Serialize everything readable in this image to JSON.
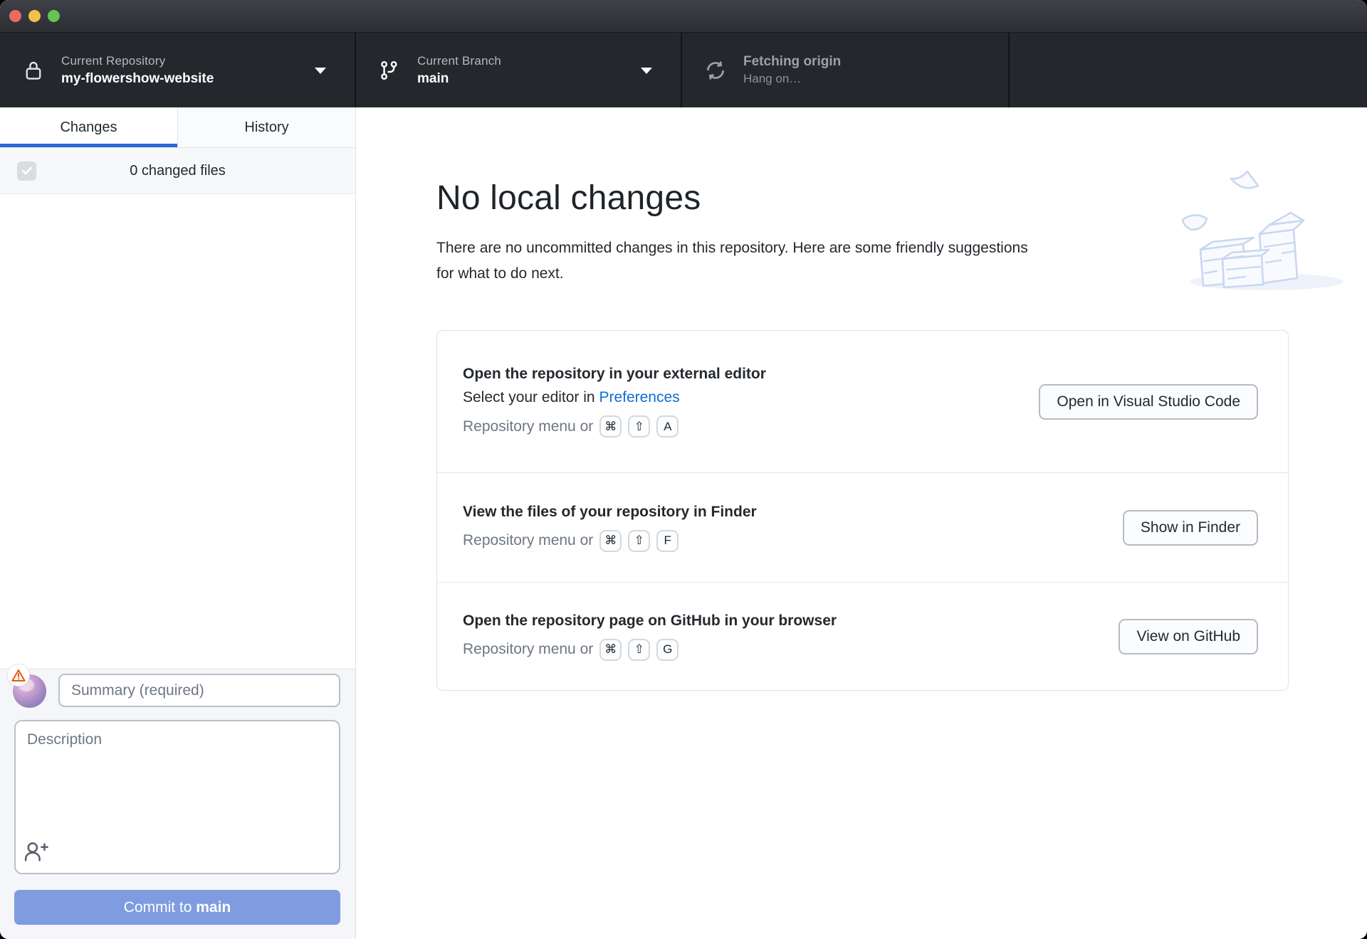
{
  "toolbar": {
    "repository": {
      "label": "Current Repository",
      "value": "my-flowershow-website"
    },
    "branch": {
      "label": "Current Branch",
      "value": "main"
    },
    "fetch": {
      "title": "Fetching origin",
      "subtitle": "Hang on…"
    }
  },
  "sidebar": {
    "tabs": [
      {
        "label": "Changes"
      },
      {
        "label": "History"
      }
    ],
    "changes_summary": "0 changed files",
    "commit": {
      "summary_placeholder": "Summary (required)",
      "description_placeholder": "Description",
      "button_prefix": "Commit to ",
      "button_branch": "main"
    }
  },
  "main": {
    "title": "No local changes",
    "subtitle_lines": [
      "There are no uncommitted changes in this repository. Here are some friendly suggestions",
      "for what to do next."
    ],
    "suggestions": [
      {
        "title": "Open the repository in your external editor",
        "subtitle_prefix": "Select your editor in ",
        "subtitle_link": "Preferences",
        "shortcut_prefix": "Repository menu or",
        "keys": [
          "⌘",
          "⇧",
          "A"
        ],
        "button": "Open in Visual Studio Code"
      },
      {
        "title": "View the files of your repository in Finder",
        "shortcut_prefix": "Repository menu or",
        "keys": [
          "⌘",
          "⇧",
          "F"
        ],
        "button": "Show in Finder"
      },
      {
        "title": "Open the repository page on GitHub in your browser",
        "shortcut_prefix": "Repository menu or",
        "keys": [
          "⌘",
          "⇧",
          "G"
        ],
        "button": "View on GitHub"
      }
    ]
  },
  "colors": {
    "accent_blue": "#2d68d8",
    "link_blue": "#0f6bd7",
    "commit_button_disabled": "#7f9ce0",
    "warning_orange": "#e8590c",
    "toolbar_bg": "#24272c",
    "illustration_blue": "#c9d7f0"
  }
}
